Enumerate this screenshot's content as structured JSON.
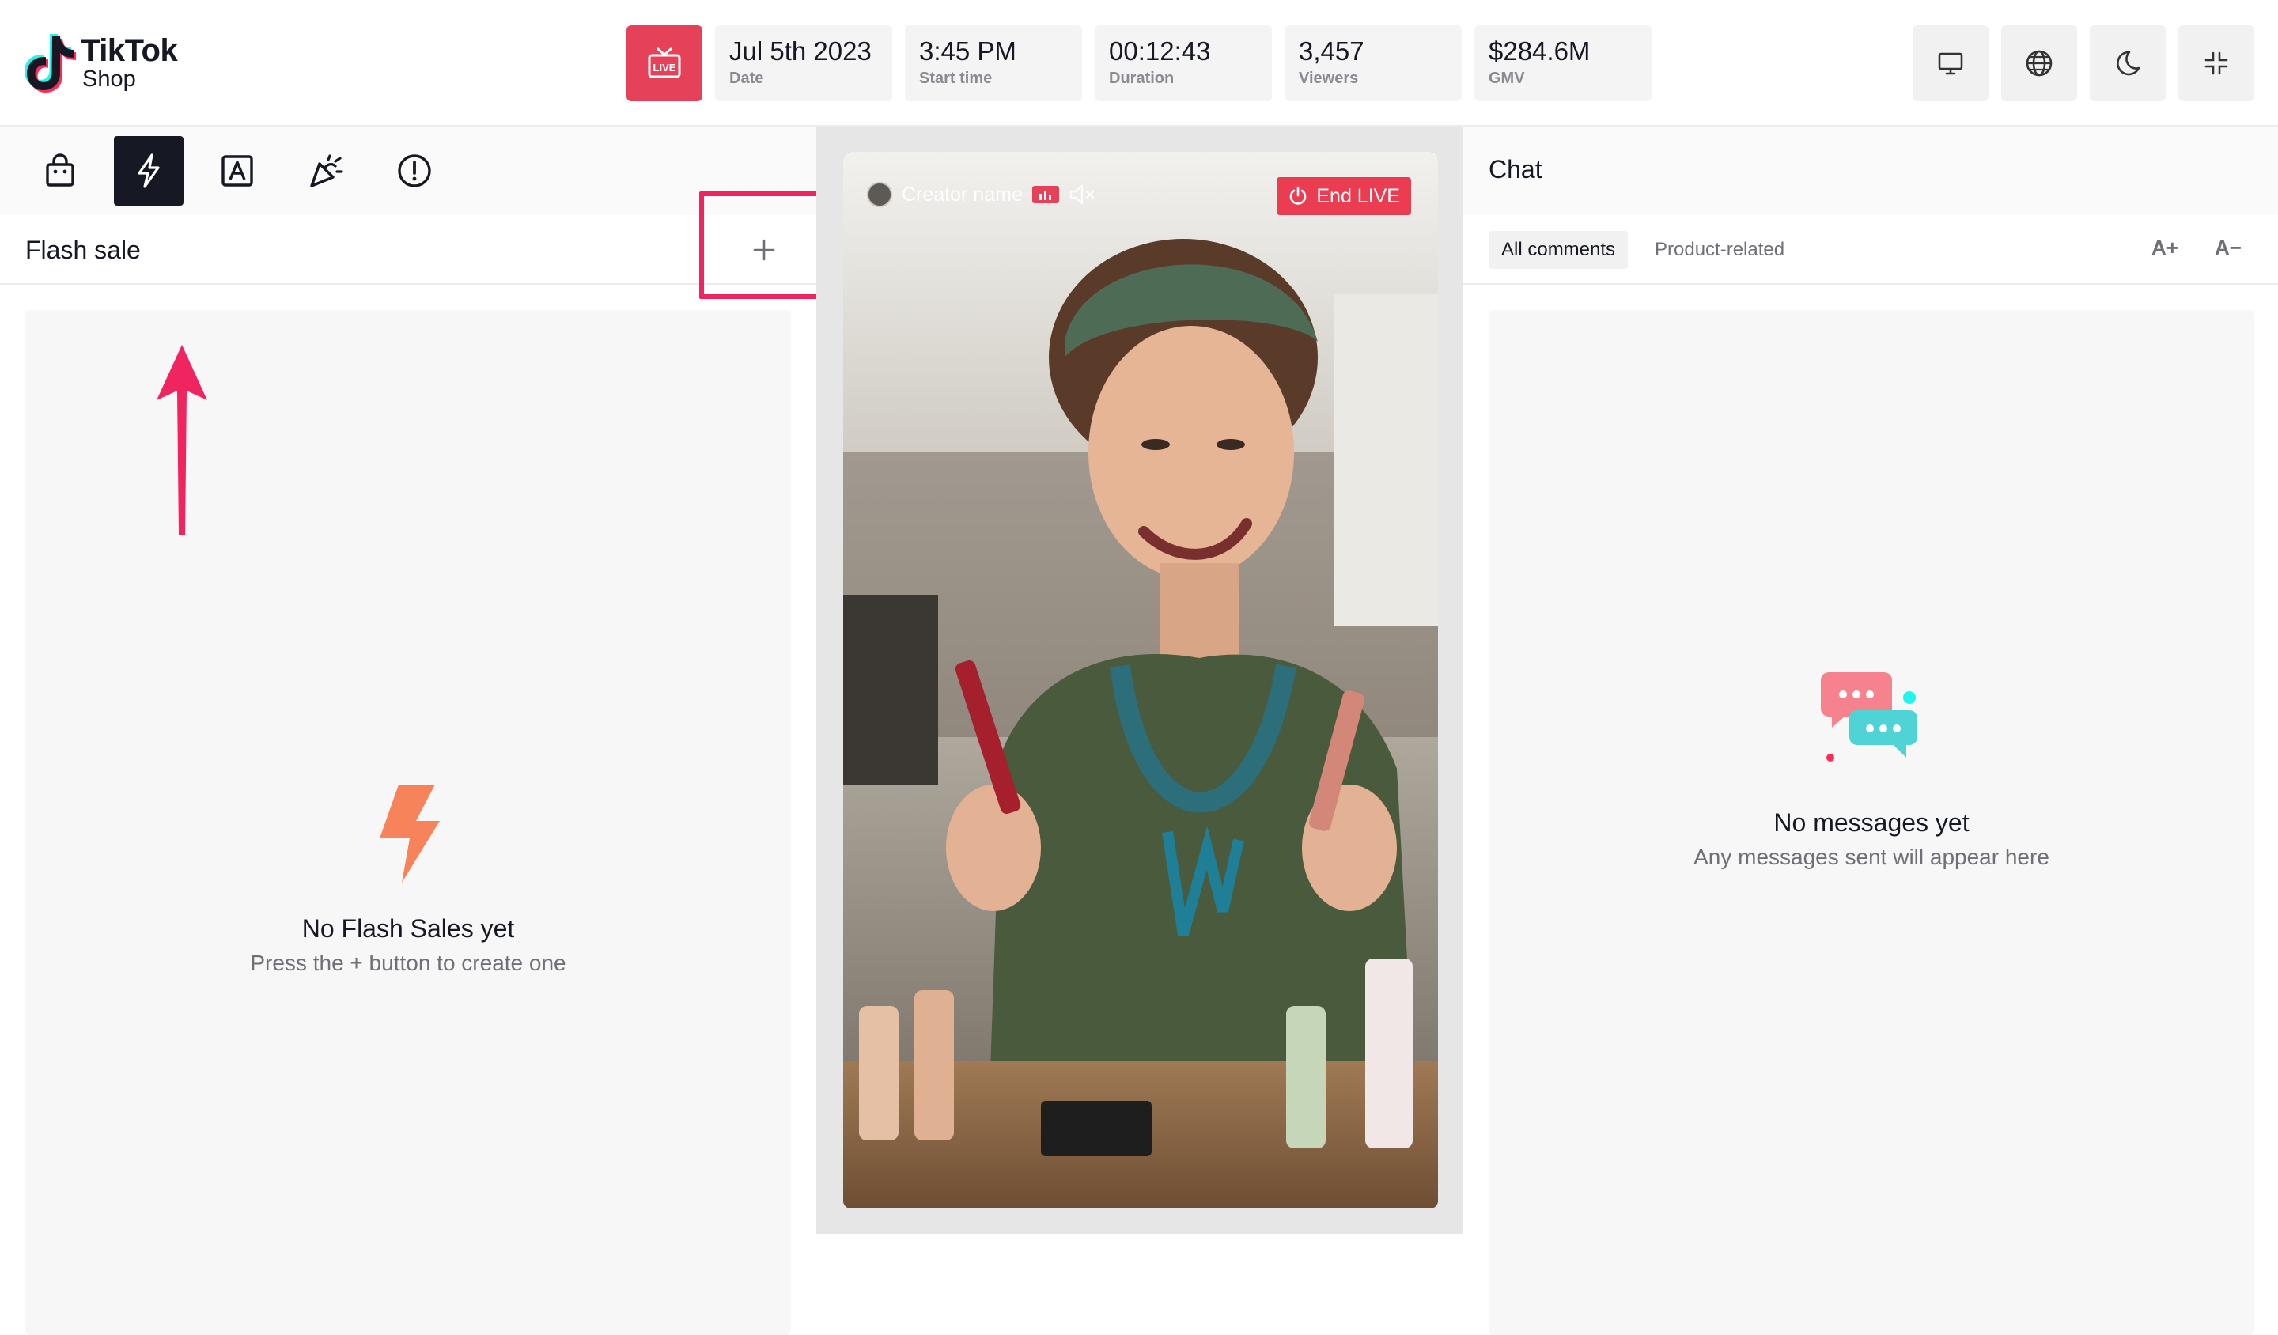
{
  "header": {
    "logo": {
      "brand": "TikTok",
      "sub": "Shop"
    },
    "live_badge_icon": "live-tv-icon",
    "stats": [
      {
        "value": "Jul 5th 2023",
        "label": "Date"
      },
      {
        "value": "3:45 PM",
        "label": "Start time"
      },
      {
        "value": "00:12:43",
        "label": "Duration"
      },
      {
        "value": "3,457",
        "label": "Viewers"
      },
      {
        "value": "$284.6M",
        "label": "GMV"
      }
    ],
    "actions": [
      "monitor-icon",
      "globe-icon",
      "moon-icon",
      "minimize-icon"
    ]
  },
  "left_panel": {
    "tools": [
      "shopping-bag-icon",
      "lightning-icon",
      "text-a-icon",
      "party-popper-icon",
      "alert-icon"
    ],
    "active_tool": "lightning-icon",
    "section_title": "Flash sale",
    "add_icon": "plus-icon",
    "empty_state": {
      "title": "No Flash Sales yet",
      "subtitle": "Press the + button to create one"
    }
  },
  "video": {
    "creator_name": "Creator name",
    "end_live_label": "End LIVE"
  },
  "chat": {
    "title": "Chat",
    "tabs": [
      "All comments",
      "Product-related"
    ],
    "font_increase": "A+",
    "font_decrease": "A−",
    "empty_state": {
      "title": "No messages yet",
      "subtitle": "Any messages sent will appear here"
    }
  },
  "colors": {
    "live_red": "#e5425a",
    "highlight_pink": "#f0245f",
    "flash_orange": "#f7835a",
    "tiktok_cyan": "#25f4ee"
  }
}
